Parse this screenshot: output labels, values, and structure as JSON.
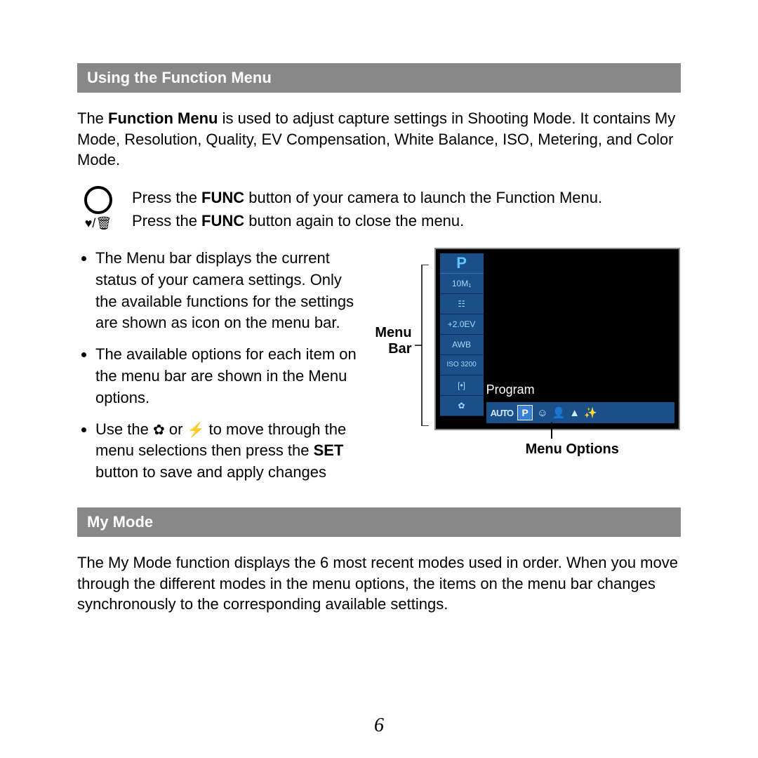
{
  "section1": {
    "title": "Using the Function Menu",
    "intro_pre": "The ",
    "intro_bold": "Function Menu",
    "intro_post": " is used to adjust capture settings in Shooting Mode. It contains My Mode, Resolution, Quality, EV Compensation, White Balance, ISO, Metering, and Color Mode.",
    "func_line1_pre": "Press the ",
    "func_line1_bold": "FUNC",
    "func_line1_post": " button of your camera to launch the Function Menu.",
    "func_line2_pre": "Press the ",
    "func_line2_bold": "FUNC",
    "func_line2_post": " button again to close the menu.",
    "bullets": {
      "b1": "The Menu bar displays the current status of your camera settings. Only the available functions for the settings are shown as icon on the menu bar.",
      "b2": "The available options for each item on the menu bar are shown in the Menu options.",
      "b3_pre": "Use the ",
      "b3_mid": " or ",
      "b3_after_icons": " to move through the menu selections then press the ",
      "b3_bold": "SET",
      "b3_post": " button to save and apply changes"
    },
    "diagram": {
      "menu_bar_label": "Menu Bar",
      "menu_options_label": "Menu Options",
      "lcd_top": "P",
      "items": [
        "10M₁",
        "☷",
        "+2.0EV",
        "AWB",
        "ISO 3200",
        "[•]",
        "✿"
      ],
      "program_label": "Program",
      "options_auto": "AUTO",
      "options_p": "P",
      "opt_icons": [
        "☺",
        "👤",
        "▲",
        "✨"
      ]
    }
  },
  "section2": {
    "title": "My Mode",
    "body": "The My Mode function displays the 6 most recent modes used in order. When you move through the different modes in the menu options, the items on the menu bar changes synchronously to the corresponding available settings."
  },
  "icons": {
    "heart": "♥",
    "slash": "/",
    "trash": "🗑",
    "macro": "✿",
    "flash": "⚡"
  },
  "page_number": "6"
}
